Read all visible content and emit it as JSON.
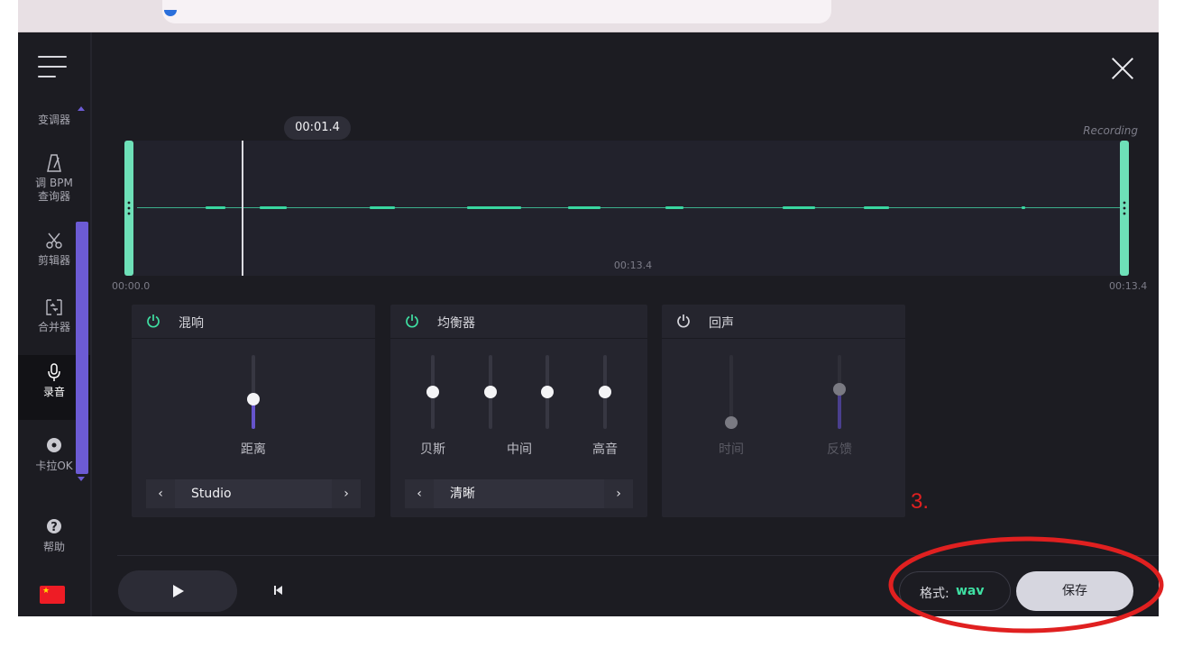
{
  "sidebar": {
    "items": [
      {
        "label": "变调器",
        "icon": "pitch-icon"
      },
      {
        "label": "调 BPM\n查询器",
        "icon": "metronome-icon"
      },
      {
        "label": "剪辑器",
        "icon": "scissors-icon"
      },
      {
        "label": "合并器",
        "icon": "merge-icon"
      },
      {
        "label": "录音",
        "icon": "microphone-icon",
        "active": true
      },
      {
        "label": "卡拉OK",
        "icon": "disc-icon"
      },
      {
        "label": "帮助",
        "icon": "help-icon"
      }
    ],
    "language_flag": "china-flag-icon"
  },
  "waveform": {
    "playhead_time": "00:01.4",
    "status": "Recording",
    "duration_mid": "00:13.4",
    "start_time": "00:00.0",
    "end_time": "00:13.4",
    "playhead_position_fraction": 0.11
  },
  "panels": {
    "reverb": {
      "title": "混响",
      "enabled": true,
      "slider_label": "距离",
      "slider_level": 0.38,
      "preset": "Studio"
    },
    "equalizer": {
      "title": "均衡器",
      "enabled": true,
      "labels": [
        "贝斯",
        "中间",
        "高音"
      ],
      "band_levels": [
        0.5,
        0.5,
        0.5,
        0.5
      ],
      "preset": "清晰"
    },
    "echo": {
      "title": "回声",
      "enabled": false,
      "labels": [
        "时间",
        "反馈"
      ],
      "levels": [
        0.0,
        0.55
      ]
    }
  },
  "bottom_bar": {
    "format_label": "格式:",
    "format_value": "wav",
    "save_label": "保存"
  },
  "annotation": {
    "step_number": "3."
  },
  "colors": {
    "accent_green": "#3fe0a3",
    "handle": "#6ee0b8",
    "slider_fill": "#6654cc",
    "annotation_red": "#e02020",
    "background": "#1c1c22"
  }
}
